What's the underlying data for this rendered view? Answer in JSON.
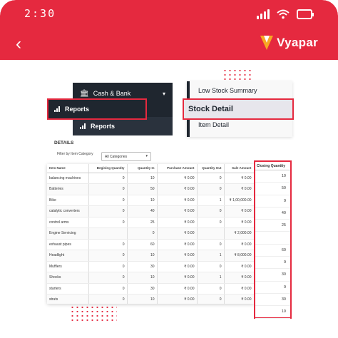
{
  "status": {
    "time": "2:30"
  },
  "appbar": {
    "back_glyph": "‹",
    "brand_name": "Vyapar",
    "accent": "#e5293f"
  },
  "nav": {
    "cash_bank": "Cash & Bank",
    "reports": "Reports",
    "reports_highlight": "Reports"
  },
  "reports_menu": {
    "low_stock": "Low Stock Summary",
    "stock_detail": "Stock Detail",
    "item_detail": "Item Detail"
  },
  "details": {
    "title": "DETAILS",
    "filter_label": "Filter by Item Category",
    "filter_value": "All Categories"
  },
  "table": {
    "headers": [
      "Item Name",
      "Begining Quantity",
      "Quantity In",
      "Purchase Amount",
      "Quantity Out",
      "Sale Amount"
    ],
    "rows": [
      [
        "balancing machines",
        "0",
        "10",
        "₹ 0.00",
        "0",
        "₹ 0.00"
      ],
      [
        "Batteries",
        "0",
        "50",
        "₹ 0.00",
        "0",
        "₹ 0.00"
      ],
      [
        "Bike",
        "0",
        "10",
        "₹ 0.00",
        "1",
        "₹ 1,00,000.00"
      ],
      [
        "catalytic converters",
        "0",
        "40",
        "₹ 0.00",
        "0",
        "₹ 0.00"
      ],
      [
        "control arms",
        "0",
        "25",
        "₹ 0.00",
        "0",
        "₹ 0.00"
      ],
      [
        "Engine Servicing",
        "",
        "0",
        "₹ 0.00",
        "",
        "₹ 2,000.00"
      ],
      [
        "exhaust pipes",
        "0",
        "60",
        "₹ 0.00",
        "0",
        "₹ 0.00"
      ],
      [
        "Headlight",
        "0",
        "10",
        "₹ 0.00",
        "1",
        "₹ 8,000.00"
      ],
      [
        "Mufflers",
        "0",
        "30",
        "₹ 0.00",
        "0",
        "₹ 0.00"
      ],
      [
        "Shocks",
        "0",
        "10",
        "₹ 0.00",
        "1",
        "₹ 0.00"
      ],
      [
        "starters",
        "0",
        "30",
        "₹ 0.00",
        "0",
        "₹ 0.00"
      ],
      [
        "struts",
        "0",
        "10",
        "₹ 0.00",
        "0",
        "₹ 0.00"
      ]
    ]
  },
  "closing": {
    "header": "Closing Quantity",
    "values": [
      "10",
      "50",
      "9",
      "40",
      "25",
      "",
      "60",
      "9",
      "30",
      "9",
      "30",
      "10"
    ]
  }
}
